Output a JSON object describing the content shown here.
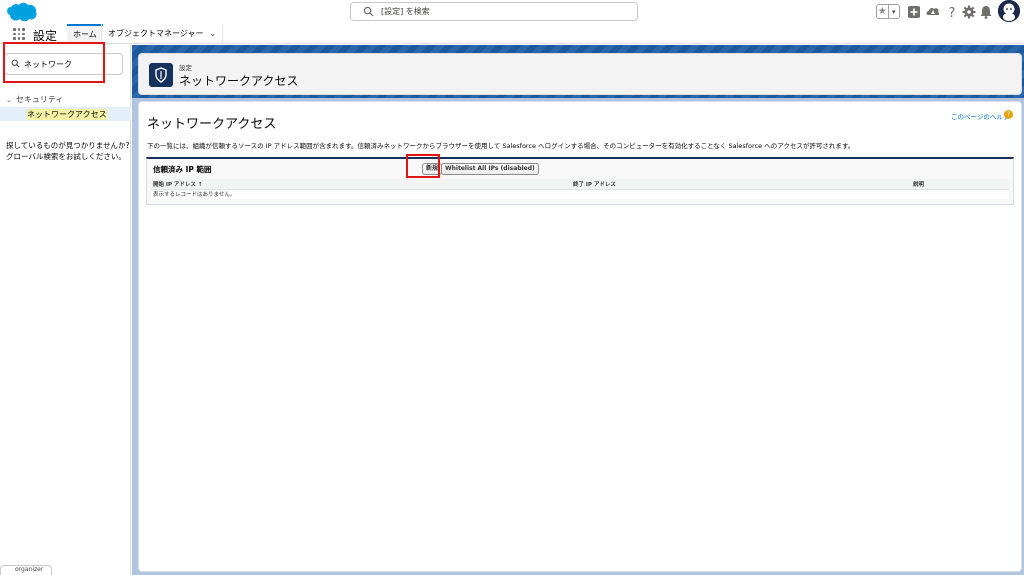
{
  "header": {
    "search_placeholder": "[設定] を検索",
    "favorite_star": "★",
    "favorite_menu": "▾"
  },
  "appnav": {
    "app_title": "設定",
    "tabs": [
      {
        "label": "ホーム",
        "active": true
      },
      {
        "label": "オブジェクトマネージャー",
        "chevron": "⌄"
      }
    ]
  },
  "sidebar": {
    "search_value": "ネットワーク",
    "tree": {
      "section_label": "セキュリティ",
      "section_chevron": "⌄",
      "item_label": "ネットワークアクセス"
    },
    "help_line1": "探しているものが見つかりませんか?",
    "help_line2": "グローバル検索をお試しください。",
    "footer_label": "organizer"
  },
  "page_header": {
    "breadcrumb": "設定",
    "title": "ネットワークアクセス"
  },
  "content": {
    "title": "ネットワークアクセス",
    "help_link": "このページのヘルプ",
    "help_icon": "?",
    "description": "下の一覧には、組織が信頼するソースの IP アドレス範囲が含まれます。信頼済みネットワークからブラウザーを使用して Salesforce へログインする場合、そのコンピューターを有効化することなく Salesforce へのアクセスが許可されます。",
    "ip_section": {
      "title": "信頼済み IP 範囲",
      "new_button": "新規",
      "whitelist_button": "Whitelist All IPs (disabled)",
      "columns": [
        "開始 IP アドレス ↑",
        "終了 IP アドレス",
        "説明"
      ],
      "empty_message": "表示するレコードはありません。"
    }
  },
  "colors": {
    "brand_blue": "#0176d3",
    "header_navy": "#16325c",
    "annotation_red": "#e01515",
    "highlight_yellow": "#f5f2a6"
  }
}
